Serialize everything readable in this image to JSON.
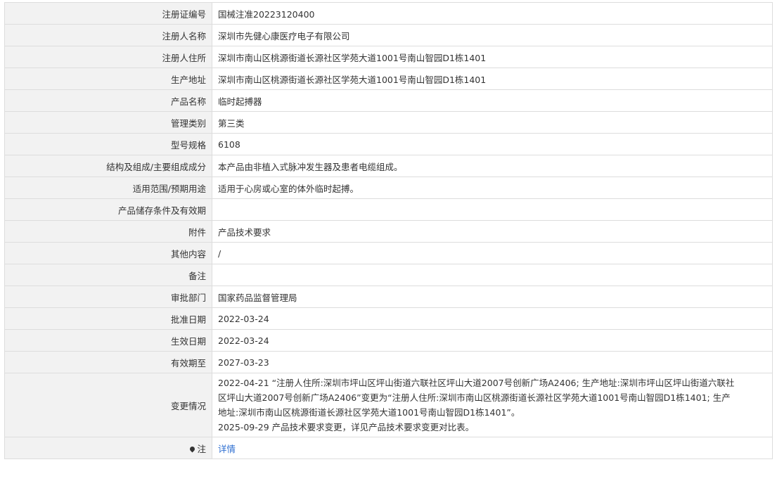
{
  "rows": [
    {
      "label": "注册证编号",
      "value": "国械注准20223120400"
    },
    {
      "label": "注册人名称",
      "value": "深圳市先健心康医疗电子有限公司"
    },
    {
      "label": "注册人住所",
      "value": "深圳市南山区桃源街道长源社区学苑大道1001号南山智园D1栋1401"
    },
    {
      "label": "生产地址",
      "value": "深圳市南山区桃源街道长源社区学苑大道1001号南山智园D1栋1401"
    },
    {
      "label": "产品名称",
      "value": "临时起搏器"
    },
    {
      "label": "管理类别",
      "value": "第三类"
    },
    {
      "label": "型号规格",
      "value": "6108"
    },
    {
      "label": "结构及组成/主要组成成分",
      "value": "本产品由非植入式脉冲发生器及患者电缆组成。"
    },
    {
      "label": "适用范围/预期用途",
      "value": "适用于心房或心室的体外临时起搏。"
    },
    {
      "label": "产品储存条件及有效期",
      "value": ""
    },
    {
      "label": "附件",
      "value": "产品技术要求"
    },
    {
      "label": "其他内容",
      "value": "/"
    },
    {
      "label": "备注",
      "value": ""
    },
    {
      "label": "审批部门",
      "value": "国家药品监督管理局"
    },
    {
      "label": "批准日期",
      "value": "2022-03-24"
    },
    {
      "label": "生效日期",
      "value": "2022-03-24"
    },
    {
      "label": "有效期至",
      "value": "2027-03-23"
    }
  ],
  "change": {
    "label": "变更情况",
    "lines": [
      "2022-04-21 “注册人住所:深圳市坪山区坪山街道六联社区坪山大道2007号创新广场A2406; 生产地址:深圳市坪山区坪山街道六联社",
      "区坪山大道2007号创新广场A2406”变更为“注册人住所:深圳市南山区桃源街道长源社区学苑大道1001号南山智园D1栋1401; 生产",
      "地址:深圳市南山区桃源街道长源社区学苑大道1001号南山智园D1栋1401”。",
      "2025-09-29 产品技术要求变更，详见产品技术要求变更对比表。"
    ]
  },
  "note": {
    "label": "注",
    "icon": "location-pin-icon",
    "link_text": "详情",
    "link_color": "#2f6fd1"
  }
}
